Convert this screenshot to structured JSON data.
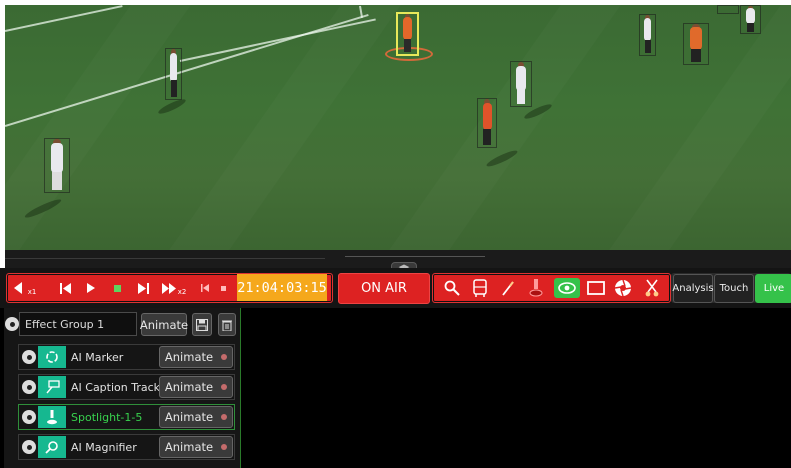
{
  "toolbar": {
    "transport": {
      "rewind_icon": "rewind-x1-icon",
      "rewind_sub": "x1",
      "prev_icon": "prev-frame-icon",
      "play_icon": "play-icon",
      "stop_icon": "stop-icon",
      "next_icon": "next-frame-icon",
      "ffwd_icon": "fast-forward-x2-icon",
      "ffwd_sub": "x2",
      "goto_start_icon": "skip-to-start-icon",
      "mini_stop_icon": "small-stop-icon"
    },
    "timecode": "21:04:03:15",
    "on_air_label": "ON AIR",
    "tools": [
      "magnifier-icon",
      "caption-bus-icon",
      "pen-icon",
      "spotlight-icon",
      "eye-icon",
      "rectangle-icon",
      "aperture-icon",
      "scissors-icon"
    ],
    "modes": [
      "Analysis",
      "Touch",
      "Live"
    ],
    "colors": {
      "accent_red": "#dd2222",
      "timecode_bg": "#f5a81c",
      "live_green": "#35c24a",
      "effect_icon_bg": "#16b890"
    }
  },
  "effect_group": {
    "name": "Effect Group 1",
    "animate_label": "Animate",
    "save_icon": "save-icon",
    "trash_icon": "trash-icon"
  },
  "effects": [
    {
      "label": "AI Marker",
      "icon": "ai-marker-icon",
      "animate_label": "Animate",
      "selected": false
    },
    {
      "label": "AI Caption Track",
      "icon": "ai-caption-track-icon",
      "animate_label": "Animate",
      "selected": false
    },
    {
      "label": "Spotlight-1-5",
      "icon": "spotlight-icon",
      "animate_label": "Animate",
      "selected": true
    },
    {
      "label": "AI Magnifier",
      "icon": "ai-magnifier-icon",
      "animate_label": "Animate",
      "selected": false
    }
  ]
}
